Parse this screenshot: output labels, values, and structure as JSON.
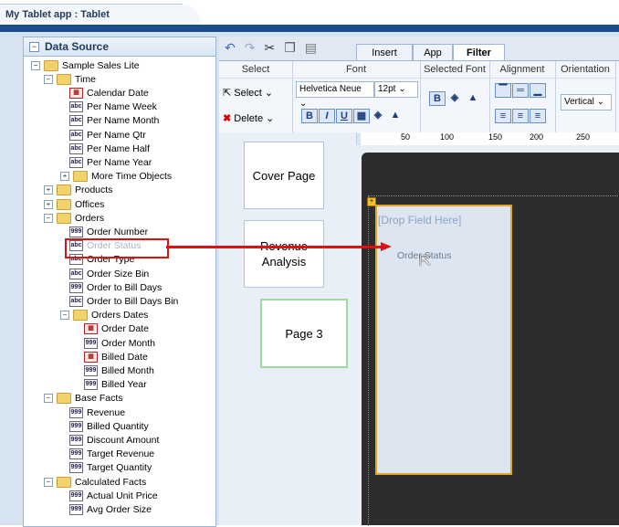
{
  "app": {
    "title": "My Tablet app : Tablet"
  },
  "data_source": {
    "header": "Data Source",
    "tree": [
      {
        "label": "Sample Sales Lite",
        "type": "folder",
        "level": 0,
        "expanded": true
      },
      {
        "label": "Time",
        "type": "folder",
        "level": 1,
        "expanded": true
      },
      {
        "label": "Calendar Date",
        "type": "date",
        "level": 2
      },
      {
        "label": "Per Name Week",
        "type": "abc",
        "level": 2
      },
      {
        "label": "Per Name Month",
        "type": "abc",
        "level": 2
      },
      {
        "label": "Per Name Qtr",
        "type": "abc",
        "level": 2
      },
      {
        "label": "Per Name Half",
        "type": "abc",
        "level": 2
      },
      {
        "label": "Per Name Year",
        "type": "abc",
        "level": 2
      },
      {
        "label": "More Time Objects",
        "type": "folder",
        "level": 2,
        "expanded": false
      },
      {
        "label": "Products",
        "type": "folder",
        "level": 1,
        "expanded": false
      },
      {
        "label": "Offices",
        "type": "folder",
        "level": 1,
        "expanded": false
      },
      {
        "label": "Orders",
        "type": "folder",
        "level": 1,
        "expanded": true
      },
      {
        "label": "Order Number",
        "type": "999",
        "level": 2
      },
      {
        "label": "Order Status",
        "type": "abc",
        "level": 2,
        "dimmed": true
      },
      {
        "label": "Order Type",
        "type": "abc",
        "level": 2
      },
      {
        "label": "Order Size Bin",
        "type": "abc",
        "level": 2
      },
      {
        "label": "Order to Bill Days",
        "type": "999",
        "level": 2
      },
      {
        "label": "Order to Bill Days Bin",
        "type": "abc",
        "level": 2
      },
      {
        "label": "Orders Dates",
        "type": "folder",
        "level": 2,
        "expanded": true
      },
      {
        "label": "Order Date",
        "type": "date",
        "level": 3
      },
      {
        "label": "Order Month",
        "type": "999",
        "level": 3
      },
      {
        "label": "Billed Date",
        "type": "date",
        "level": 3
      },
      {
        "label": "Billed Month",
        "type": "999",
        "level": 3
      },
      {
        "label": "Billed Year",
        "type": "999",
        "level": 3
      },
      {
        "label": "Base Facts",
        "type": "folder",
        "level": 1,
        "expanded": true
      },
      {
        "label": "Revenue",
        "type": "999",
        "level": 2
      },
      {
        "label": "Billed Quantity",
        "type": "999",
        "level": 2
      },
      {
        "label": "Discount Amount",
        "type": "999",
        "level": 2
      },
      {
        "label": "Target Revenue",
        "type": "999",
        "level": 2
      },
      {
        "label": "Target Quantity",
        "type": "999",
        "level": 2
      },
      {
        "label": "Calculated Facts",
        "type": "folder",
        "level": 1,
        "expanded": true
      },
      {
        "label": "Actual Unit Price",
        "type": "999",
        "level": 2
      },
      {
        "label": "Avg Order Size",
        "type": "999",
        "level": 2
      }
    ]
  },
  "tabs": [
    "Insert",
    "App",
    "Filter"
  ],
  "active_tab": "Filter",
  "ribbon": {
    "select": {
      "header": "Select",
      "select_label": "Select",
      "delete_label": "Delete"
    },
    "font": {
      "header": "Font",
      "family": "Helvetica Neue",
      "size": "12pt"
    },
    "selected_font": {
      "header": "Selected Font"
    },
    "alignment": {
      "header": "Alignment"
    },
    "orientation": {
      "header": "Orientation",
      "value": "Vertical"
    }
  },
  "pages": [
    "Cover Page",
    "Revenue Analysis",
    "Page 3"
  ],
  "ruler": [
    "50",
    "100",
    "150",
    "200",
    "250"
  ],
  "canvas": {
    "placeholder": "[Drop Field Here]",
    "drag_label": "Order Status"
  },
  "colors": {
    "highlight": "#e01010",
    "dropzone_border": "#e3a42a",
    "canvas_bg": "#2d2d2d"
  }
}
